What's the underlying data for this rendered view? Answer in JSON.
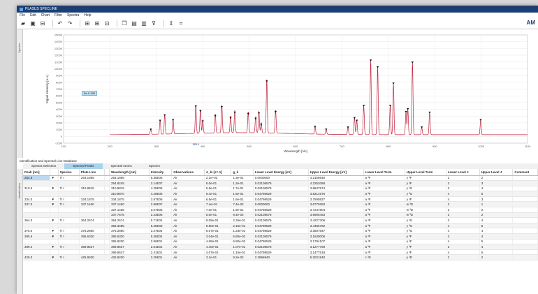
{
  "window": {
    "title": "PLASUS SPECLINE"
  },
  "menu": [
    "File",
    "Edit",
    "Chart",
    "Filter",
    "Spectra",
    "Help"
  ],
  "brand": "AM",
  "sidebars": {
    "top": "Spectra",
    "bottom": "Identification"
  },
  "chart": {
    "peak_badge": "Ba II 455",
    "xlabel": "Wavelength [nm]",
    "ylabel": "Signal intensity [a.u.]",
    "cursor_label": "385.4"
  },
  "chart_data": {
    "type": "line",
    "xlabel": "Wavelength [nm]",
    "ylabel": "Signal intensity [a.u.]",
    "xlim": [
      100,
      1100
    ],
    "ylim": [
      -1000,
      15000
    ],
    "x_ticks": [
      100,
      200,
      300,
      400,
      500,
      600,
      700,
      800,
      900,
      1000,
      1100
    ],
    "y_ticks": [
      -1000,
      0,
      1000,
      2000,
      3000,
      4000,
      5000,
      6000,
      7000,
      8000,
      9000,
      10000,
      11000,
      12000,
      13000,
      14000,
      15000
    ],
    "series": [
      {
        "values_peaks": [
          [
            288,
            800
          ],
          [
            308,
            2100
          ],
          [
            318,
            2900
          ],
          [
            336,
            2200
          ],
          [
            385,
            4200
          ],
          [
            395,
            3500
          ],
          [
            400,
            2000
          ],
          [
            427,
            2800
          ],
          [
            441,
            4100
          ],
          [
            460,
            2500
          ],
          [
            469,
            3300
          ],
          [
            498,
            3100
          ],
          [
            514,
            2400
          ],
          [
            521,
            3200
          ],
          [
            526,
            1500
          ],
          [
            538,
            7900
          ],
          [
            557,
            3400
          ],
          [
            642,
            1200
          ],
          [
            666,
            800
          ],
          [
            713,
            1100
          ],
          [
            727,
            2500
          ],
          [
            732,
            2100
          ],
          [
            747,
            4300
          ],
          [
            762,
            11000
          ],
          [
            777,
            10000
          ],
          [
            804,
            4300
          ],
          [
            811,
            7600
          ],
          [
            838,
            3400
          ],
          [
            842,
            3800
          ],
          [
            852,
            10700
          ],
          [
            872,
            1100
          ],
          [
            889,
            3300
          ],
          [
            999,
            2200
          ]
        ]
      }
    ],
    "grid": true,
    "legend": "none"
  },
  "section_title": "Identification and Spectral Line Database",
  "tabs": [
    "Spectra Selection",
    "Spectral Peaks",
    "Spectral Atoms",
    "Species"
  ],
  "table": {
    "headers": [
      "Peak [nm]",
      "",
      "Species",
      "Plate Line",
      "",
      "Wavelength [nm]",
      "Intensity",
      "Observations",
      "A_ki [s^-1]",
      "g_k",
      "Lower Level Energy [eV]",
      "Upper Level Energy [eV]",
      "Lower Level Term",
      "Upper Level Term",
      "Lower Level J",
      "Upper Level J",
      "Comment"
    ],
    "rows": [
      [
        "254.5",
        "▼",
        "Ti I",
        "254.1885",
        "",
        "254.1885",
        "5.35E05",
        "Air",
        "2.1e+02",
        "1.3e-01",
        "0.0000000",
        "4.2159840",
        "a ³F",
        "y ³F",
        "2",
        "2",
        ""
      ],
      [
        "",
        "",
        "",
        "",
        "",
        "254.8245",
        "3.14E07",
        "Air",
        "5.0e-01",
        "1.2e-01",
        "0.02108578",
        "4.2252088",
        "a ³F",
        "y ³F",
        "3",
        "3",
        ""
      ],
      [
        "310.5",
        "▼",
        "Ti I",
        "310.8815",
        "",
        "310.8815",
        "4.25E06",
        "Air",
        "5.5e-01",
        "1.7e-01",
        "0.02108578",
        "3.8847874",
        "a ³F",
        "y ³G",
        "3",
        "4",
        ""
      ],
      [
        "",
        "",
        "",
        "",
        "",
        "310.9870",
        "4.28E06",
        "Air",
        "9.4e-01",
        "1.6e-01",
        "0.04798529",
        "3.8214575",
        "a ³F",
        "y ³G",
        "4",
        "5",
        ""
      ],
      [
        "334.0",
        "▼",
        "Ti I",
        "334.1875",
        "",
        "334.1875",
        "3.87E06",
        "Air",
        "6.5e-01",
        "1.6e-01",
        "0.04798529",
        "3.7590827",
        "a ³F",
        "y ³F",
        "4",
        "3",
        ""
      ],
      [
        "337.0",
        "▼",
        "Ti I",
        "337.1460",
        "",
        "337.1460",
        "2.86E07",
        "Air",
        "7.4e+01",
        "7.4e-02",
        "0.0000000",
        "3.6779283",
        "a ³F",
        "w ³D",
        "2",
        "1",
        ""
      ],
      [
        "",
        "",
        "",
        "",
        "",
        "337.1465",
        "3.07E06",
        "Air",
        "7.0e-01",
        "1.9e-01",
        "0.04798529",
        "3.7247804",
        "a ³F",
        "w ³D",
        "3",
        "2",
        ""
      ],
      [
        "",
        "",
        "",
        "",
        "",
        "337.7575",
        "2.23E06",
        "Air",
        "5.0e-01",
        "9.4e-02",
        "0.02108578",
        "3.6900453",
        "a ³F",
        "w ³D",
        "3",
        "2",
        ""
      ],
      [
        "364.0",
        "▼",
        "Ti I",
        "364.2674",
        "",
        "364.2674",
        "5.71E04",
        "Air",
        "9.05e-01",
        "2.26e-01",
        "0.02108578",
        "3.4227306",
        "a ³F",
        "y ³G",
        "3",
        "4",
        ""
      ],
      [
        "",
        "",
        "",
        "",
        "",
        "365.3485",
        "5.25E03",
        "Air",
        "8.50e-01",
        "2.15e-01",
        "0.04798529",
        "3.4465782",
        "a ³F",
        "y ³G",
        "4",
        "5",
        ""
      ],
      [
        "375.0",
        "▼",
        "Ti I",
        "375.2860",
        "",
        "375.2860",
        "3.27E04",
        "Air",
        "6.07e-01",
        "1.23e-01",
        "0.04798529",
        "3.3507847",
        "a ³F",
        "y ³G",
        "4",
        "4",
        ""
      ],
      [
        "395.6",
        "▼",
        "Ti I",
        "395.6330",
        "",
        "395.6330",
        "5.36E04",
        "Air",
        "3.04e-01",
        "6.80e-02",
        "0.02108578",
        "3.1640006",
        "a ³F",
        "y ³F",
        "3",
        "4",
        ""
      ],
      [
        "",
        "",
        "",
        "",
        "",
        "395.8200",
        "2.06E01",
        "Air",
        "4.08e-01",
        "6.80e-02",
        "0.04798529",
        "3.1794107",
        "a ³F",
        "y ³F",
        "4",
        "5",
        ""
      ],
      [
        "399.4",
        "▼",
        "Ti I",
        "399.8637",
        "",
        "399.8637",
        "2.61E01",
        "Air",
        "4.40e-01",
        "1.07e-01",
        "0.02108578",
        "3.1277759",
        "a ³F",
        "y ³F",
        "3",
        "4",
        ""
      ],
      [
        "",
        "",
        "",
        "",
        "",
        "399.8637",
        "2.41E01",
        "Air",
        "4.07e-01",
        "1.15e-01",
        "0.04798529",
        "3.1477518",
        "a ³F",
        "y ³F",
        "4",
        "5",
        ""
      ],
      [
        "425.0",
        "▼",
        "Ti I",
        "425.9200",
        "",
        "425.9200",
        "2.25E01",
        "Air",
        "3.1e-01",
        "9.2e-02",
        "2.2966940",
        "5.2021840",
        "c ³D",
        "y ³D",
        "2",
        "2",
        ""
      ]
    ]
  }
}
